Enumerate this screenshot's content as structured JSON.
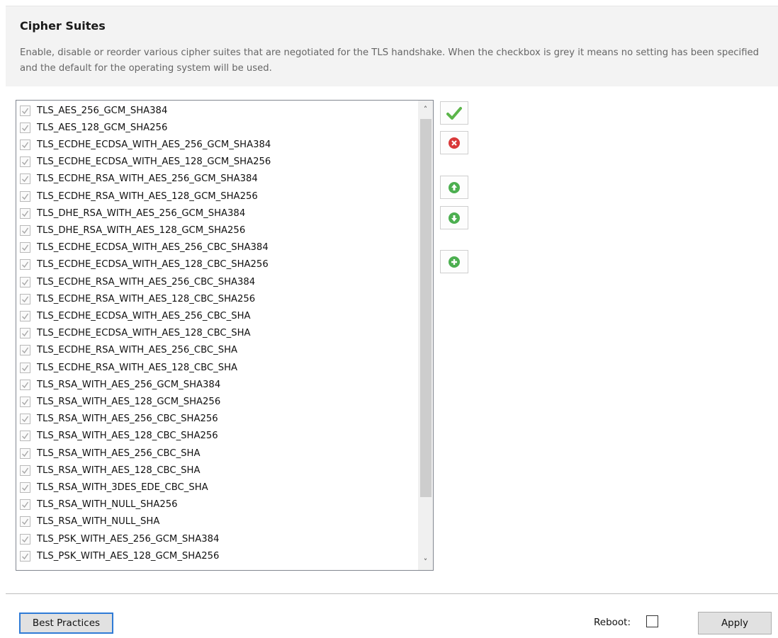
{
  "header": {
    "title": "Cipher Suites",
    "description": "Enable, disable or reorder various cipher suites that are negotiated for the TLS handshake. When the checkbox is grey it means no setting has been specified and the default for the operating system will be used."
  },
  "cipher_list": {
    "items": [
      "TLS_AES_256_GCM_SHA384",
      "TLS_AES_128_GCM_SHA256",
      "TLS_ECDHE_ECDSA_WITH_AES_256_GCM_SHA384",
      "TLS_ECDHE_ECDSA_WITH_AES_128_GCM_SHA256",
      "TLS_ECDHE_RSA_WITH_AES_256_GCM_SHA384",
      "TLS_ECDHE_RSA_WITH_AES_128_GCM_SHA256",
      "TLS_DHE_RSA_WITH_AES_256_GCM_SHA384",
      "TLS_DHE_RSA_WITH_AES_128_GCM_SHA256",
      "TLS_ECDHE_ECDSA_WITH_AES_256_CBC_SHA384",
      "TLS_ECDHE_ECDSA_WITH_AES_128_CBC_SHA256",
      "TLS_ECDHE_RSA_WITH_AES_256_CBC_SHA384",
      "TLS_ECDHE_RSA_WITH_AES_128_CBC_SHA256",
      "TLS_ECDHE_ECDSA_WITH_AES_256_CBC_SHA",
      "TLS_ECDHE_ECDSA_WITH_AES_128_CBC_SHA",
      "TLS_ECDHE_RSA_WITH_AES_256_CBC_SHA",
      "TLS_ECDHE_RSA_WITH_AES_128_CBC_SHA",
      "TLS_RSA_WITH_AES_256_GCM_SHA384",
      "TLS_RSA_WITH_AES_128_GCM_SHA256",
      "TLS_RSA_WITH_AES_256_CBC_SHA256",
      "TLS_RSA_WITH_AES_128_CBC_SHA256",
      "TLS_RSA_WITH_AES_256_CBC_SHA",
      "TLS_RSA_WITH_AES_128_CBC_SHA",
      "TLS_RSA_WITH_3DES_EDE_CBC_SHA",
      "TLS_RSA_WITH_NULL_SHA256",
      "TLS_RSA_WITH_NULL_SHA",
      "TLS_PSK_WITH_AES_256_GCM_SHA384",
      "TLS_PSK_WITH_AES_128_GCM_SHA256"
    ],
    "checkbox_state": "grey-checked"
  },
  "toolbar": {
    "buttons": [
      {
        "name": "enable",
        "icon": "green-check-icon"
      },
      {
        "name": "disable",
        "icon": "red-x-icon"
      },
      {
        "name": "move-up",
        "icon": "green-up-arrow-icon"
      },
      {
        "name": "move-down",
        "icon": "green-down-arrow-icon"
      },
      {
        "name": "add",
        "icon": "green-plus-icon"
      }
    ]
  },
  "footer": {
    "best_practices_label": "Best Practices",
    "reboot_label": "Reboot:",
    "reboot_checked": false,
    "apply_label": "Apply"
  },
  "colors": {
    "header_bg": "#f3f3f3",
    "focus_border": "#2f7bd6",
    "icon_green": "#4caf50",
    "icon_red": "#d9393a"
  }
}
